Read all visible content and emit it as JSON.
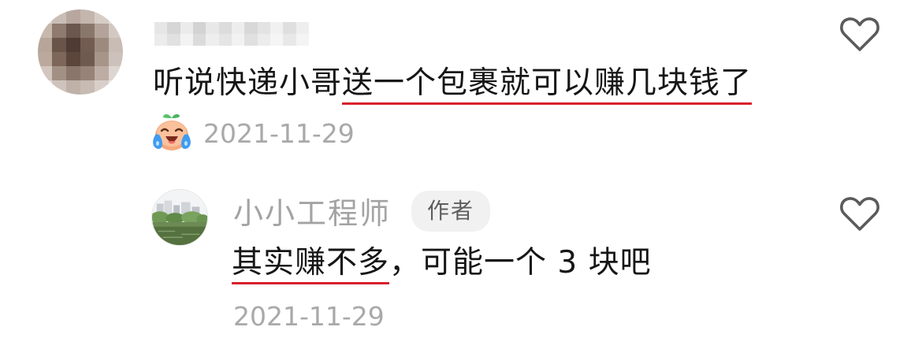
{
  "comments": [
    {
      "avatar": "pixelated-avatar",
      "author_name": "",
      "text_prefix": "听说快递小哥",
      "text_underlined": "送一个包裹就可以赚几块钱了",
      "reaction_icon": "crying-laughing-emoji-icon",
      "date": "2021-11-29",
      "like_icon": "heart-outline-icon"
    }
  ],
  "reply": {
    "avatar": "landscape-photo-avatar",
    "author_name": "小小工程师",
    "author_badge": "作者",
    "text_underlined": "其实赚不多",
    "text_rest": "，可能一个 3 块吧",
    "date": "2021-11-29",
    "like_icon": "heart-outline-icon"
  },
  "colors": {
    "underline": "#d8202c",
    "meta_text": "#a9a9a9",
    "body_text": "#161616",
    "badge_bg": "#f1f1f1"
  }
}
